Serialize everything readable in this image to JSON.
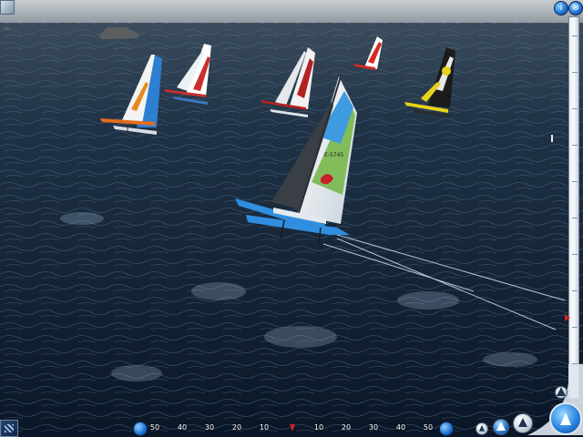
{
  "window": {
    "info_button": "i",
    "close_button": "⊗"
  },
  "scale_bar": {
    "labels": [
      "50",
      "40",
      "30",
      "20",
      "10",
      "",
      "10",
      "20",
      "30",
      "40",
      "50"
    ],
    "center_marker_color": "#d2201c"
  },
  "hud": {
    "left_icon": "boat-left-icon",
    "right_icon": "boat-right-icon",
    "slider_marker_color": "#d2201c"
  },
  "boats": [
    {
      "name": "lead-catamaran",
      "hull_color": "#2f8ee0",
      "sail_color": "#e9eef2"
    },
    {
      "name": "catamaran-far-left",
      "hull_color": "#e66d1d",
      "sail_color": "#2e7fd1"
    },
    {
      "name": "catamaran-center-left",
      "hull_color": "#c9302c",
      "sail_color": "#ffffff"
    },
    {
      "name": "catamaran-center",
      "hull_color": "#b22222",
      "sail_color": "#f2f2f2"
    },
    {
      "name": "catamaran-far-right-red",
      "hull_color": "#d52a23",
      "sail_color": "#ffffff"
    },
    {
      "name": "catamaran-right-yellow",
      "hull_color": "#e6d21a",
      "sail_color": "#1b1b1b"
    }
  ],
  "lead_boat_sail_text": "E-5745"
}
